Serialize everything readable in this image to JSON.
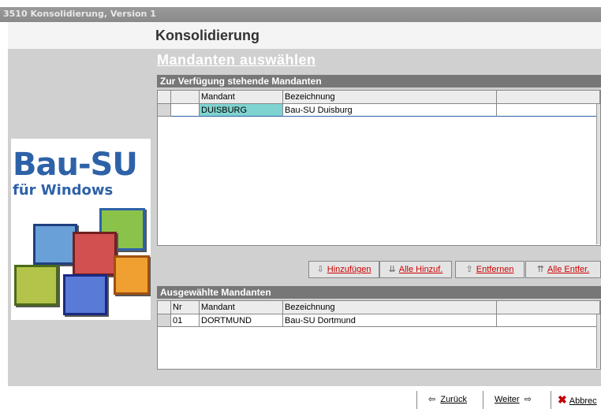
{
  "window": {
    "title": "3510 Konsolidierung, Version  1"
  },
  "header": {
    "title": "Konsolidierung"
  },
  "section": {
    "title": "Mandanten auswählen"
  },
  "logo": {
    "line1": "Bau-SU",
    "line2": "für Windows"
  },
  "available": {
    "heading": "Zur Verfügung stehende Mandanten",
    "columns": [
      "Mandant",
      "Bezeichnung"
    ],
    "rows": [
      {
        "mandant": "DUISBURG",
        "bezeichnung": "Bau-SU Duisburg"
      }
    ]
  },
  "actions": {
    "add": "Hinzufügen",
    "add_all": "Alle Hinzuf.",
    "remove": "Entfernen",
    "remove_all": "Alle Entfer."
  },
  "selected": {
    "heading": "Ausgewählte Mandanten",
    "columns": [
      "Nr",
      "Mandant",
      "Bezeichnung"
    ],
    "rows": [
      {
        "nr": "01",
        "mandant": "DORTMUND",
        "bezeichnung": "Bau-SU Dortmund"
      }
    ]
  },
  "footer": {
    "back": "Zurück",
    "next": "Weiter",
    "cancel": "Abbrec"
  },
  "colors": {
    "accent": "#2e62a8",
    "selection": "#7fd3d0",
    "danger": "#c00000"
  }
}
